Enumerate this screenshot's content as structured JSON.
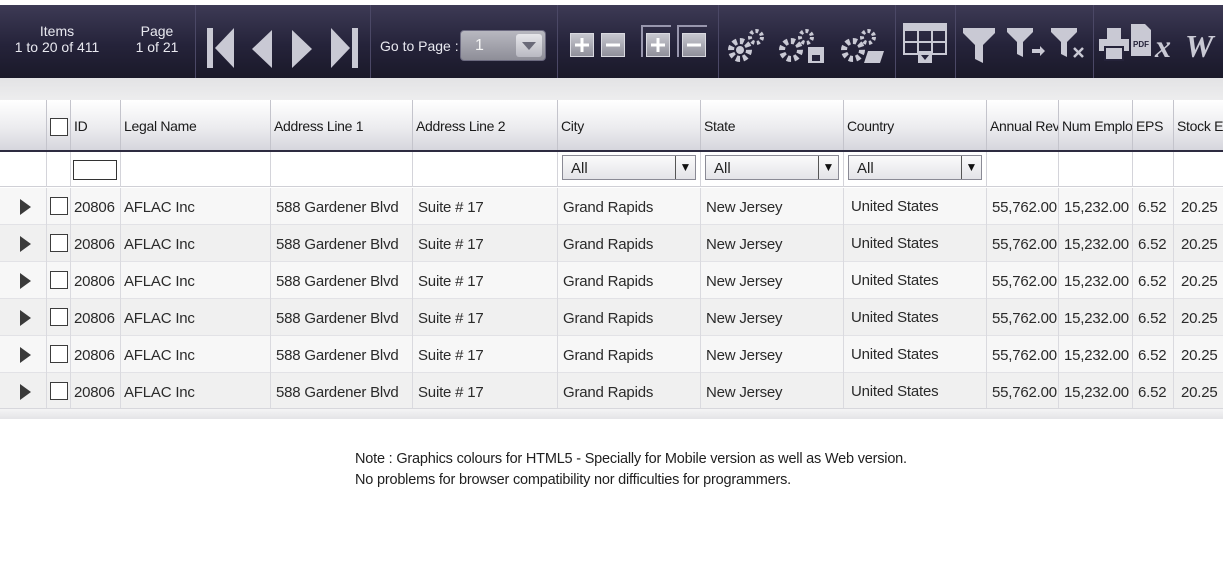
{
  "toolbar": {
    "items_label": "Items",
    "items_range": "1 to 20 of 411",
    "page_label": "Page",
    "page_range": "1 of 21",
    "goto_label": "Go to Page :",
    "goto_value": "1",
    "icons": [
      "first-page-icon",
      "prev-page-icon",
      "next-page-icon",
      "last-page-icon",
      "expand-all-icon",
      "collapse-all-icon",
      "expand-group-icon",
      "collapse-group-icon",
      "settings-icon",
      "settings-save-icon",
      "settings-open-icon",
      "column-chooser-icon",
      "filter-icon",
      "filter-apply-icon",
      "filter-clear-icon",
      "print-icon",
      "pdf-export-icon",
      "excel-export-icon",
      "word-export-icon"
    ],
    "colors": {
      "bar": "#25233a",
      "icon": "#c9c9d4"
    }
  },
  "grid": {
    "columns": [
      "ID",
      "Legal Name",
      "Address Line 1",
      "Address Line 2",
      "City",
      "State",
      "Country",
      "Annual Rev",
      "Num Employ",
      "EPS",
      "Stock Ex"
    ],
    "filters": {
      "city": "All",
      "state": "All",
      "country": "All"
    },
    "rows": [
      [
        "20806",
        "AFLAC Inc",
        "588 Gardener Blvd",
        "Suite # 17",
        "Grand Rapids",
        "New Jersey",
        "United States",
        "55,762.00",
        "15,232.00",
        "6.52",
        "20.25"
      ],
      [
        "20806",
        "AFLAC Inc",
        "588 Gardener Blvd",
        "Suite # 17",
        "Grand Rapids",
        "New Jersey",
        "United States",
        "55,762.00",
        "15,232.00",
        "6.52",
        "20.25"
      ],
      [
        "20806",
        "AFLAC Inc",
        "588 Gardener Blvd",
        "Suite # 17",
        "Grand Rapids",
        "New Jersey",
        "United States",
        "55,762.00",
        "15,232.00",
        "6.52",
        "20.25"
      ],
      [
        "20806",
        "AFLAC Inc",
        "588 Gardener Blvd",
        "Suite # 17",
        "Grand Rapids",
        "New Jersey",
        "United States",
        "55,762.00",
        "15,232.00",
        "6.52",
        "20.25"
      ],
      [
        "20806",
        "AFLAC Inc",
        "588 Gardener Blvd",
        "Suite # 17",
        "Grand Rapids",
        "New Jersey",
        "United States",
        "55,762.00",
        "15,232.00",
        "6.52",
        "20.25"
      ],
      [
        "20806",
        "AFLAC Inc",
        "588 Gardener Blvd",
        "Suite # 17",
        "Grand Rapids",
        "New Jersey",
        "United States",
        "55,762.00",
        "15,232.00",
        "6.52",
        "20.25"
      ]
    ]
  },
  "note": {
    "line1": "Note : Graphics colours for HTML5 - Specially for Mobile version as well as Web version.",
    "line2": "No problems for browser compatibility nor difficulties for programmers."
  }
}
